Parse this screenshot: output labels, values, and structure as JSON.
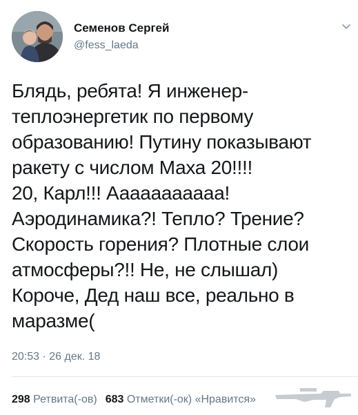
{
  "author": {
    "name": "Семенов Сергей",
    "handle": "@fess_laeda"
  },
  "icons": {
    "avatar": "avatar-photo",
    "caret": "chevron-down-icon",
    "watermark": "rifle-watermark"
  },
  "tweet": {
    "lines": [
      "Блядь, ребята! Я инженер-",
      "теплоэнергетик по первому",
      "образованию! Путину показывают",
      "ракету с числом Маха 20!!!!",
      "20, Карл!!! Ааааааааааа!",
      "Аэродинамика?! Тепло? Трение?",
      "Скорость горения? Плотные слои",
      "атмосферы?!! Не, не слышал)",
      "Короче, Дед наш все, реально в",
      "маразме("
    ],
    "timestamp": "20:53 · 26 дек. 18"
  },
  "stats": {
    "retweets_count": "298",
    "retweets_label": "Ретвита(-ов)",
    "likes_count": "683",
    "likes_label": "Отметки(-ок) «Нравится»"
  },
  "colors": {
    "text": "#14171a",
    "secondary": "#657786",
    "divider": "#e1e8ed"
  }
}
